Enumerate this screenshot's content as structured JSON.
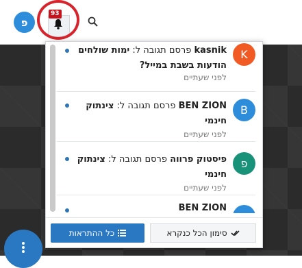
{
  "header": {
    "user_avatar_letter": "פ",
    "notification_count": "93"
  },
  "notifications": [
    {
      "avatar_letter": "K",
      "avatar_color": "#f15a22",
      "user": "kasnik",
      "action": "פרסם תגובה ל:",
      "topic": "ימות שולחים הודעות בשבת במייל?",
      "time": "לפני שעתיים"
    },
    {
      "avatar_letter": "B",
      "avatar_color": "#2e8ddb",
      "user": "BEN ZION",
      "action": "פרסם תגובה ל:",
      "topic": "צינתוק חינמי",
      "time": "לפני שעתיים"
    },
    {
      "avatar_letter": "פ",
      "avatar_color": "#19927a",
      "user": "פיסטוק פרווה",
      "action": "פרסם תגובה ל:",
      "topic": "צינתוק חינמי",
      "time": "לפני שעתיים"
    },
    {
      "avatar_letter": "",
      "avatar_color": "#2e8ddb",
      "user": "BEN ZION",
      "action": "",
      "topic": "",
      "time": ""
    }
  ],
  "footer": {
    "all_notifications_label": "כל ההתראות",
    "mark_all_read_label": "סימון הכל כנקרא"
  }
}
